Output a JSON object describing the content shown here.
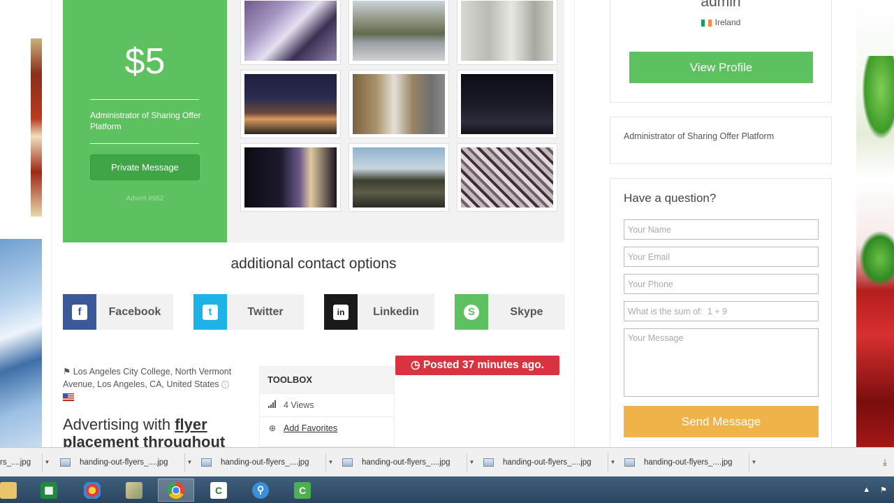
{
  "price_card": {
    "price": "$5",
    "description": "Administrator of Sharing Offer Platform",
    "private_message_label": "Private Message",
    "advert_id": "Advert #952"
  },
  "gallery": {
    "photos": [
      "interior-doorway-photo",
      "hollywood-street-photo",
      "wall-posters-photo",
      "night-street-photo",
      "bulletin-board-photo",
      "dark-street-photo",
      "night-storefront-photo",
      "palm-street-photo",
      "newsstand-photo"
    ]
  },
  "contact": {
    "section_title": "additional contact options",
    "options": [
      {
        "label": "Facebook",
        "icon": "facebook-icon",
        "glyph": "f",
        "color": "#3b5998"
      },
      {
        "label": "Twitter",
        "icon": "twitter-icon",
        "glyph": "t",
        "color": "#1eb3e6"
      },
      {
        "label": "Linkedin",
        "icon": "linkedin-icon",
        "glyph": "in",
        "color": "#1a1a1a"
      },
      {
        "label": "Skype",
        "icon": "skype-icon",
        "glyph": "S",
        "color": "#5cc15e"
      }
    ]
  },
  "listing": {
    "location": "Los Angeles City College, North Vermont Avenue, Los Angeles, CA, United States",
    "title_prefix": "Advertising with ",
    "title_keyword": "flyer",
    "title_rest": "placement throughout",
    "posted": "Posted 37 minutes ago."
  },
  "toolbox": {
    "heading": "TOOLBOX",
    "views": "4 Views",
    "add_favorites": "Add Favorites"
  },
  "profile": {
    "name": "admin",
    "country": "Ireland",
    "view_profile_label": "View Profile",
    "description": "Administrator of Sharing Offer Platform"
  },
  "question_form": {
    "title": "Have a question?",
    "name_placeholder": "Your Name",
    "email_placeholder": "Your Email",
    "phone_placeholder": "Your Phone",
    "sum_placeholder": "What is the sum of:  1 + 9",
    "message_placeholder": "Your Message",
    "send_label": "Send Message"
  },
  "downloads": {
    "items": [
      "handing-out-flyers_....jpg",
      "handing-out-flyers_....jpg",
      "handing-out-flyers_....jpg",
      "handing-out-flyers_....jpg",
      "handing-out-flyers_....jpg"
    ],
    "partial_item": "rs_....jpg"
  },
  "colors": {
    "accent_green": "#5cc15e",
    "posted_red": "#d9333f",
    "send_orange": "#efb34a"
  }
}
